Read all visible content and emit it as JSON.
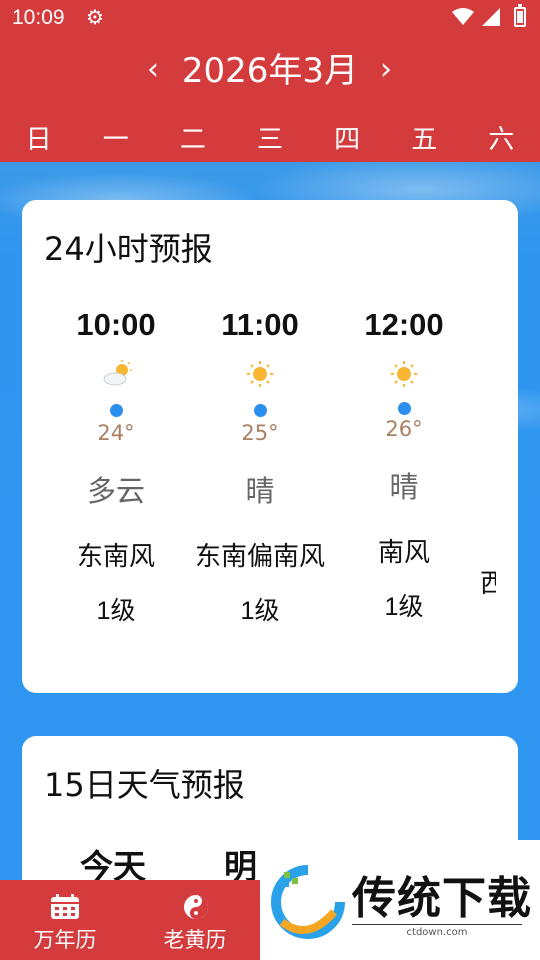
{
  "status": {
    "time": "10:09"
  },
  "header": {
    "month_title": "2026年3月",
    "prev_label": "‹",
    "next_label": "›"
  },
  "weekdays": [
    "日",
    "一",
    "二",
    "三",
    "四",
    "五",
    "六"
  ],
  "hourly": {
    "title": "24小时预报",
    "items": [
      {
        "time": "10:00",
        "icon": "partly-cloudy-icon",
        "temp": "24°",
        "condition": "多云",
        "wind": "东南风",
        "level": "1级"
      },
      {
        "time": "11:00",
        "icon": "sun-icon",
        "temp": "25°",
        "condition": "晴",
        "wind": "东南偏南风",
        "level": "1级"
      },
      {
        "time": "12:00",
        "icon": "sun-icon",
        "temp": "26°",
        "condition": "晴",
        "wind": "南风",
        "level": "1级"
      },
      {
        "wind": "西"
      }
    ]
  },
  "daily": {
    "title": "15日天气预报",
    "days": [
      "今天",
      "明"
    ]
  },
  "bottom_nav": {
    "tabs": [
      "万年历",
      "老黄历"
    ]
  },
  "watermark": {
    "brand": "传统下载",
    "url": "ctdown.com"
  },
  "colors": {
    "header": "#d33b3c",
    "accent_blue": "#2b8ff0",
    "temp_text": "#a98062"
  }
}
